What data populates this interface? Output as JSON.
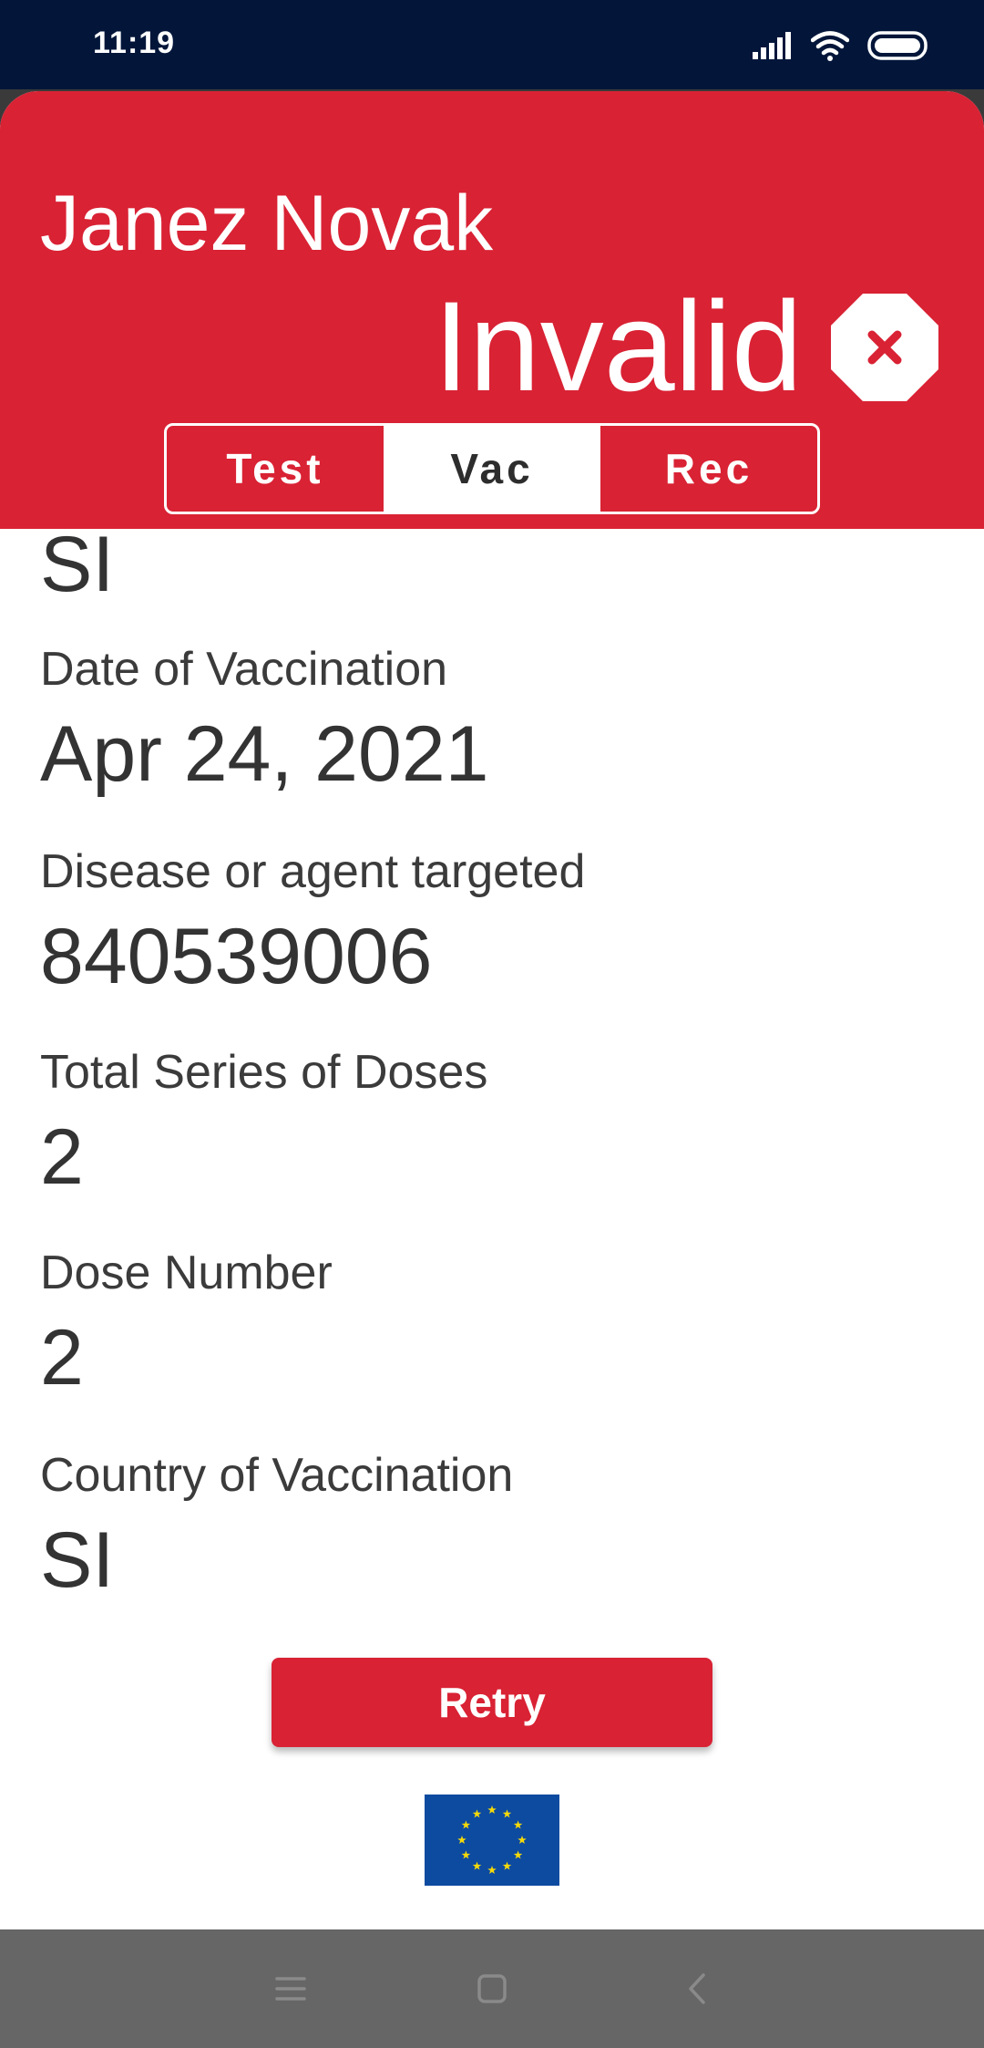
{
  "status_bar": {
    "time": "11:19"
  },
  "header": {
    "name": "Janez Novak",
    "status": "Invalid",
    "tabs": [
      {
        "label": "Test",
        "active": false
      },
      {
        "label": "Vac",
        "active": true
      },
      {
        "label": "Rec",
        "active": false
      }
    ]
  },
  "details": {
    "partial_value": "SI",
    "fields": [
      {
        "label": "Date of Vaccination",
        "value": "Apr 24, 2021"
      },
      {
        "label": "Disease or agent targeted",
        "value": "840539006"
      },
      {
        "label": "Total Series of Doses",
        "value": "2"
      },
      {
        "label": "Dose Number",
        "value": "2"
      },
      {
        "label": "Country of Vaccination",
        "value": "SI"
      }
    ]
  },
  "actions": {
    "retry_label": "Retry"
  },
  "colors": {
    "accent": "#d92234",
    "status_bar": "#03163a",
    "nav_bar": "#666666",
    "eu_blue": "#0d4ba0",
    "eu_star": "#f5d90a"
  },
  "icons": [
    "signal-icon",
    "wifi-icon",
    "battery-icon",
    "invalid-octagon-icon",
    "eu-flag-icon",
    "menu-icon",
    "home-icon",
    "back-icon"
  ]
}
